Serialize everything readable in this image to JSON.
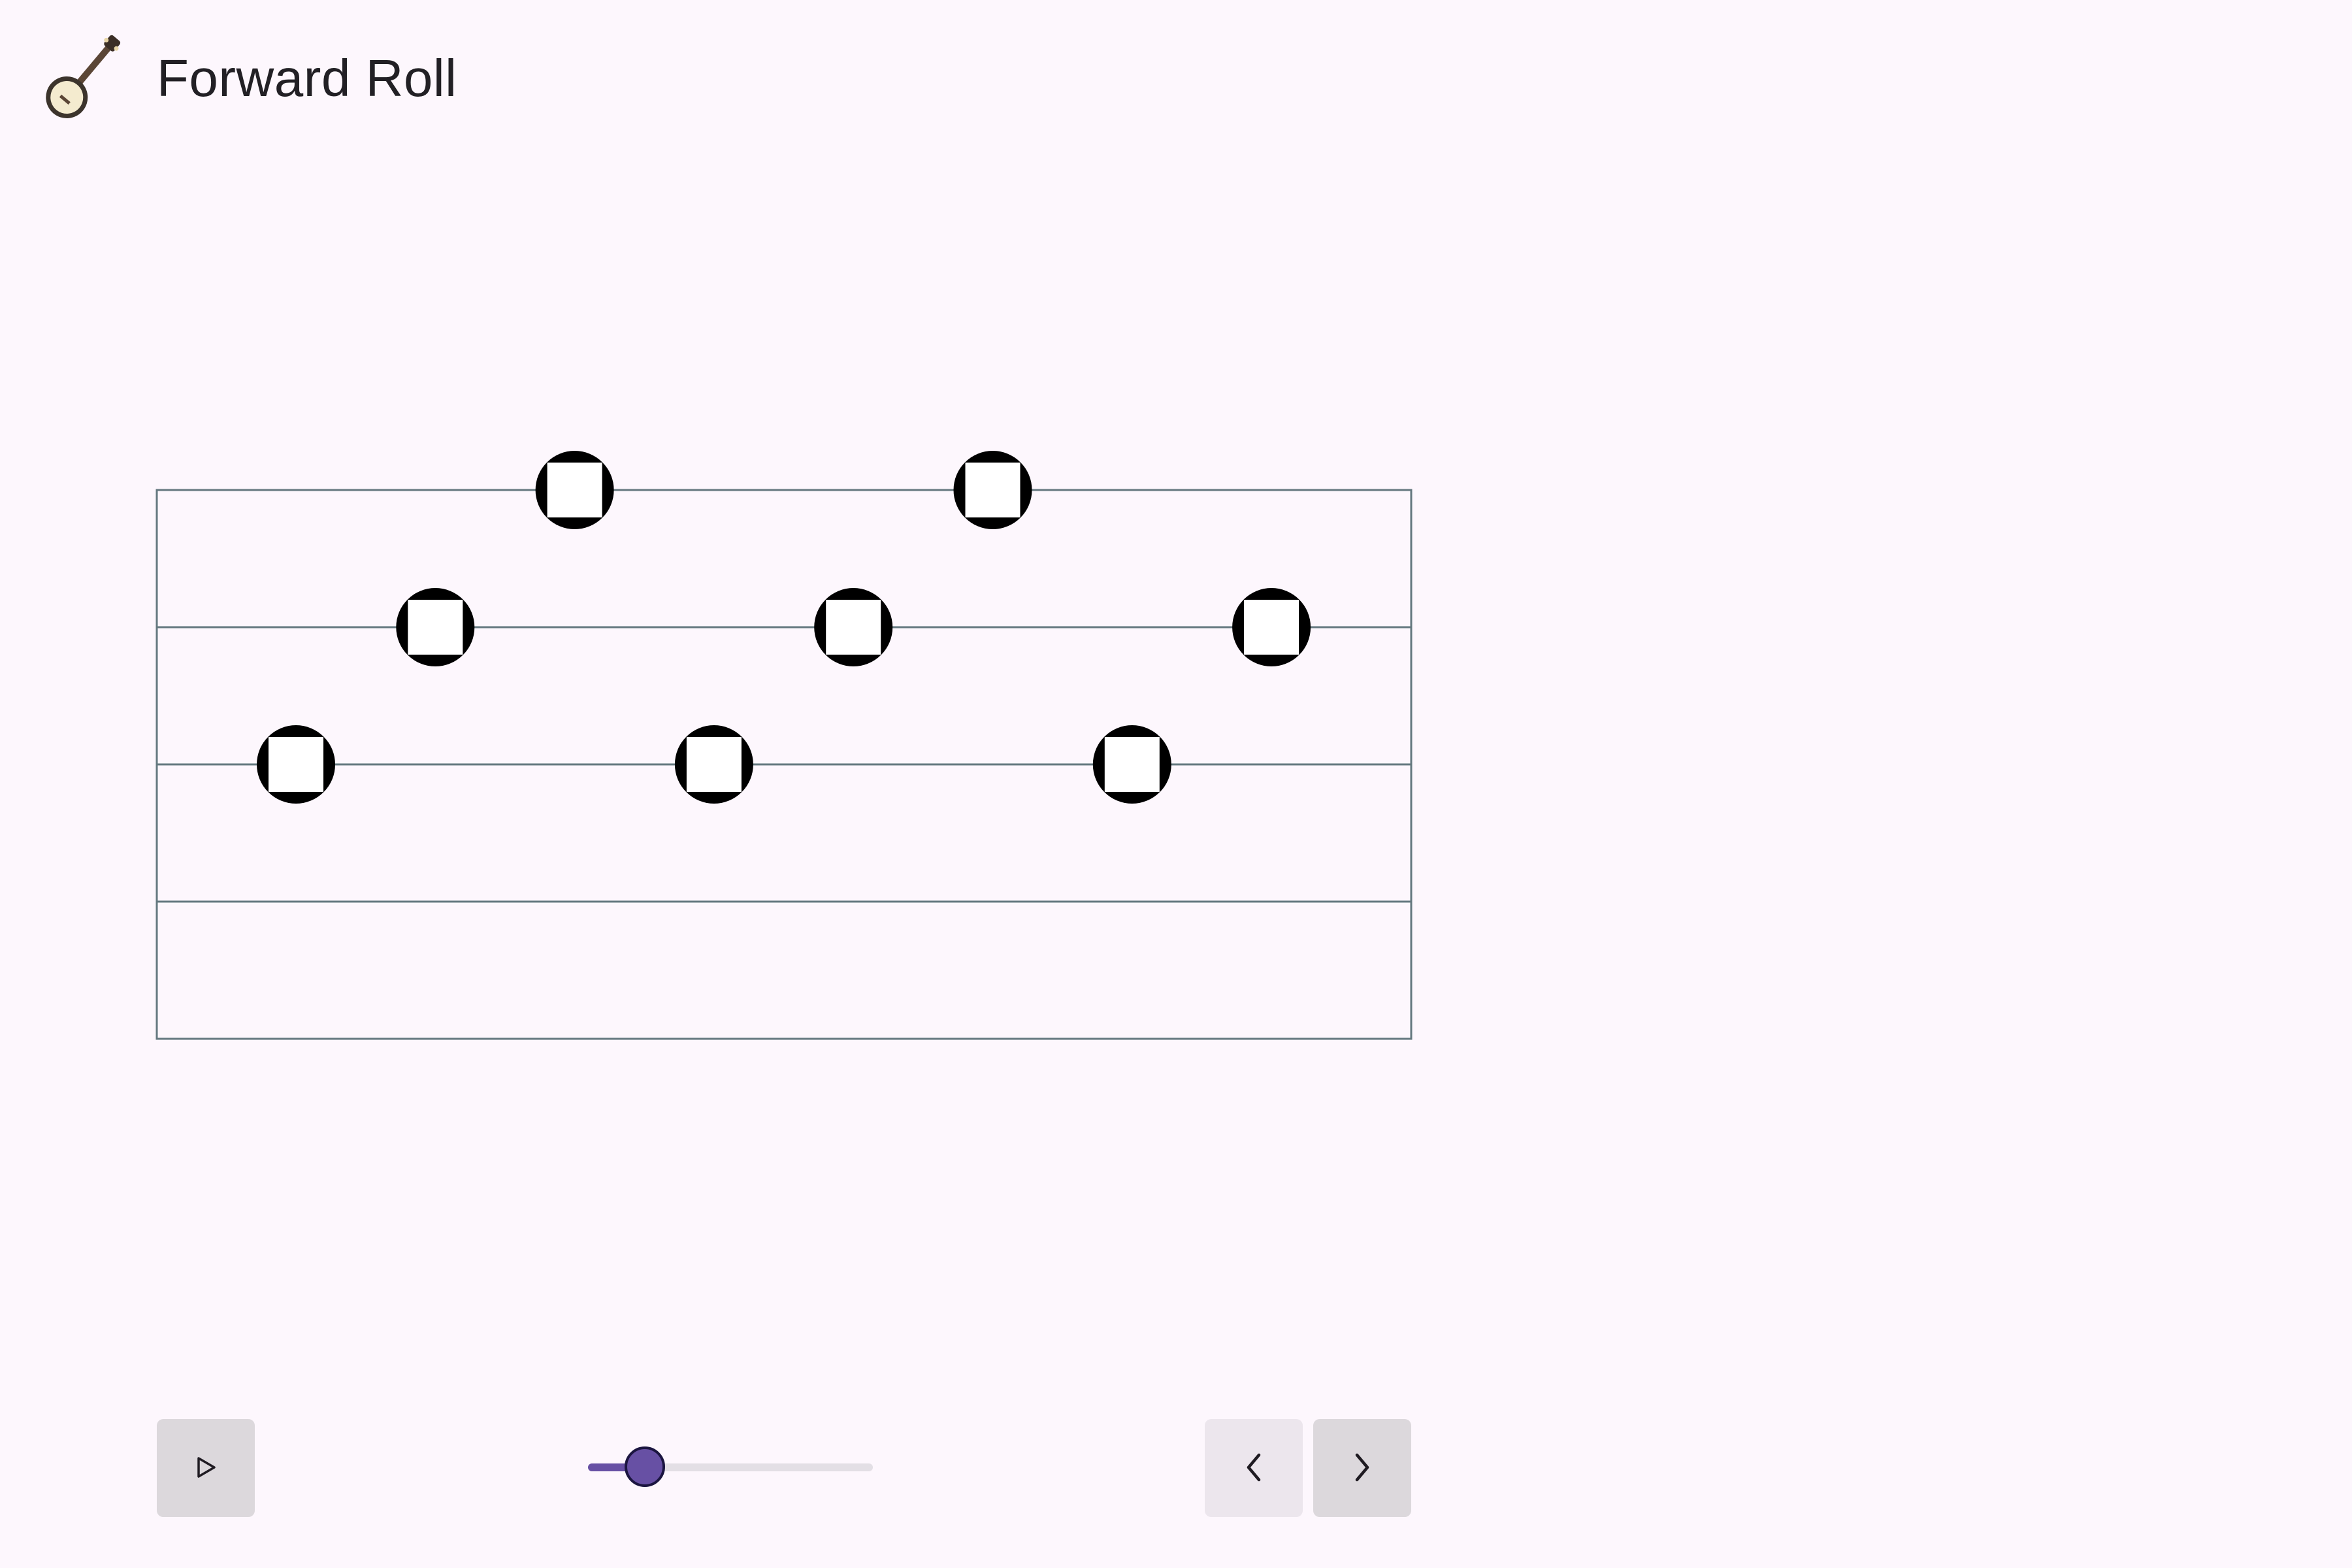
{
  "header": {
    "title": "Forward Roll",
    "logo_icon": "banjo-icon"
  },
  "tab": {
    "strings": 5,
    "steps": 8,
    "notes": [
      {
        "step": 1,
        "string": 3
      },
      {
        "step": 2,
        "string": 2
      },
      {
        "step": 3,
        "string": 1
      },
      {
        "step": 4,
        "string": 3
      },
      {
        "step": 5,
        "string": 2
      },
      {
        "step": 6,
        "string": 1
      },
      {
        "step": 7,
        "string": 3
      },
      {
        "step": 8,
        "string": 2
      }
    ],
    "note_icon": "note-marker-icon",
    "colors": {
      "line": "#64787f",
      "note_fill": "#000000",
      "note_inner": "#ffffff"
    }
  },
  "controls": {
    "play_icon": "play-icon",
    "prev_icon": "chevron-left-icon",
    "next_icon": "chevron-right-icon",
    "tempo_slider": {
      "value_fraction": 0.2
    },
    "colors": {
      "accent": "#6750a4"
    }
  }
}
